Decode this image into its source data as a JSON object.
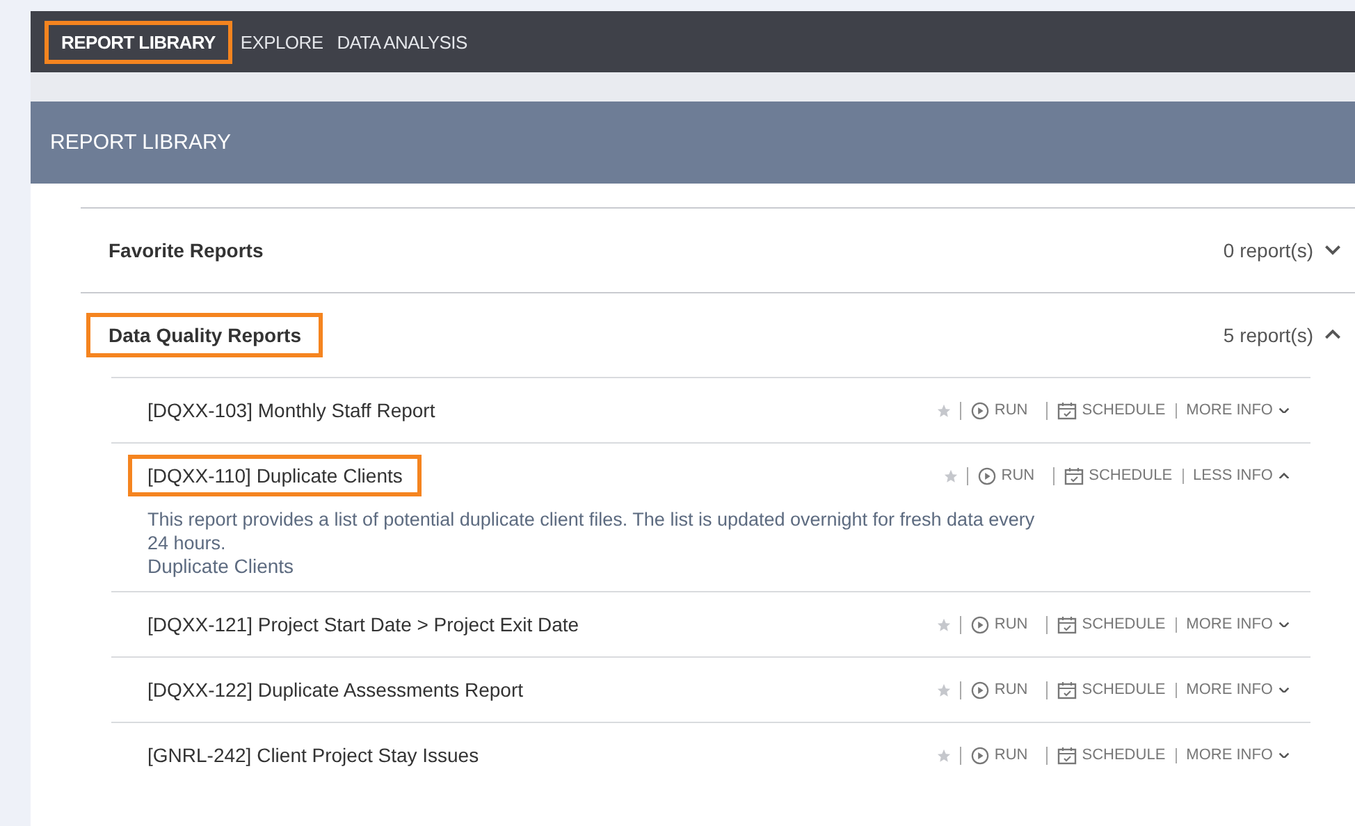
{
  "nav": {
    "items": [
      {
        "label": "REPORT LIBRARY",
        "selected": true,
        "highlighted": true
      },
      {
        "label": "EXPLORE",
        "selected": false,
        "highlighted": false
      },
      {
        "label": "DATA ANALYSIS",
        "selected": false,
        "highlighted": false
      }
    ]
  },
  "header": {
    "title": "REPORT LIBRARY"
  },
  "sections": [
    {
      "title": "Favorite Reports",
      "count": "0 report(s)",
      "expanded": false,
      "highlighted": false
    },
    {
      "title": "Data Quality Reports",
      "count": "5 report(s)",
      "expanded": true,
      "highlighted": true,
      "reports": [
        {
          "title": "[DQXX-103] Monthly Staff Report",
          "highlighted": false,
          "expanded": false,
          "run": "RUN",
          "schedule": "SCHEDULE",
          "info": "MORE INFO"
        },
        {
          "title": "[DQXX-110] Duplicate Clients",
          "highlighted": true,
          "expanded": true,
          "run": "RUN",
          "schedule": "SCHEDULE",
          "info": "LESS INFO",
          "description": "This report provides a list of potential duplicate client files. The list is updated overnight for fresh data every 24 hours.",
          "link": "Duplicate Clients"
        },
        {
          "title": "[DQXX-121] Project Start Date > Project Exit Date",
          "highlighted": false,
          "expanded": false,
          "run": "RUN",
          "schedule": "SCHEDULE",
          "info": "MORE INFO"
        },
        {
          "title": "[DQXX-122] Duplicate Assessments Report",
          "highlighted": false,
          "expanded": false,
          "run": "RUN",
          "schedule": "SCHEDULE",
          "info": "MORE INFO"
        },
        {
          "title": "[GNRL-242] Client Project Stay Issues",
          "highlighted": false,
          "expanded": false,
          "run": "RUN",
          "schedule": "SCHEDULE",
          "info": "MORE INFO"
        }
      ]
    }
  ]
}
